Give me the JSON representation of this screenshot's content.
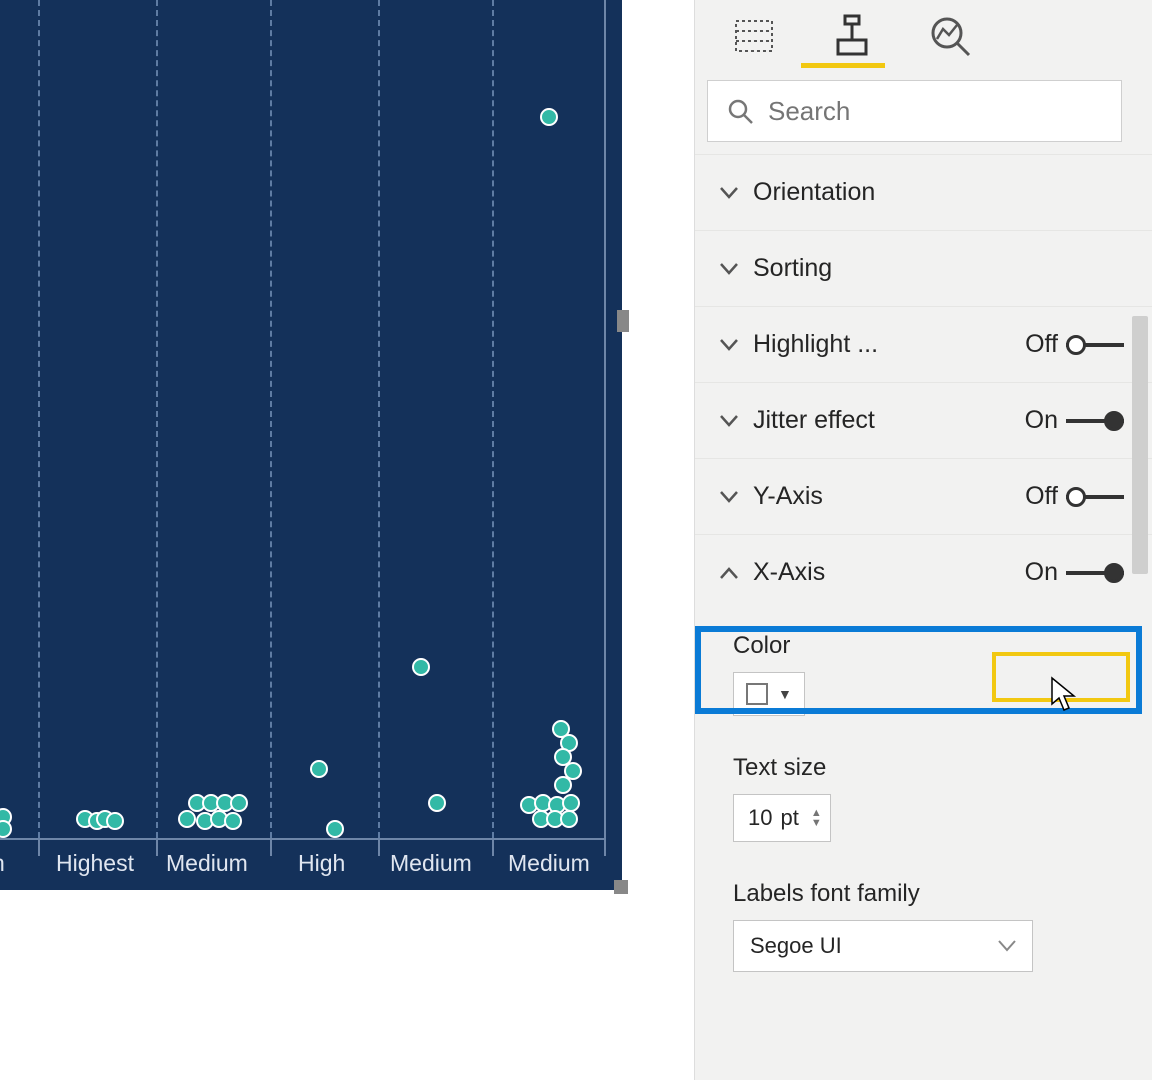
{
  "search": {
    "placeholder": "Search"
  },
  "sections": {
    "orientation": {
      "label": "Orientation"
    },
    "sorting": {
      "label": "Sorting"
    },
    "highlight": {
      "label": "Highlight ...",
      "state": "Off"
    },
    "jitter": {
      "label": "Jitter effect",
      "state": "On"
    },
    "yaxis": {
      "label": "Y-Axis",
      "state": "Off"
    },
    "xaxis": {
      "label": "X-Axis",
      "state": "On"
    }
  },
  "xaxis_settings": {
    "color_label": "Color",
    "text_size_label": "Text size",
    "text_size_value": "10",
    "text_size_unit": "pt",
    "font_family_label": "Labels font family",
    "font_family_value": "Segoe UI"
  },
  "chart_data": {
    "type": "scatter",
    "title": "",
    "xlabel": "",
    "ylabel": "",
    "categories": [
      "h",
      "Highest",
      "Medium",
      "High",
      "Medium",
      "Medium"
    ],
    "series": [
      {
        "name": "points",
        "points": [
          {
            "cat": 0,
            "y": 2
          },
          {
            "cat": 0,
            "y": 3
          },
          {
            "cat": 1,
            "y": 2
          },
          {
            "cat": 1,
            "y": 2
          },
          {
            "cat": 1,
            "y": 2
          },
          {
            "cat": 1,
            "y": 3
          },
          {
            "cat": 2,
            "y": 2
          },
          {
            "cat": 2,
            "y": 2
          },
          {
            "cat": 2,
            "y": 2
          },
          {
            "cat": 2,
            "y": 2
          },
          {
            "cat": 2,
            "y": 3
          },
          {
            "cat": 2,
            "y": 3
          },
          {
            "cat": 2,
            "y": 3
          },
          {
            "cat": 2,
            "y": 3
          },
          {
            "cat": 3,
            "y": 7
          },
          {
            "cat": 3,
            "y": 8
          },
          {
            "cat": 4,
            "y": 4
          },
          {
            "cat": 4,
            "y": 20
          },
          {
            "cat": 5,
            "y": 2
          },
          {
            "cat": 5,
            "y": 2
          },
          {
            "cat": 5,
            "y": 2
          },
          {
            "cat": 5,
            "y": 3
          },
          {
            "cat": 5,
            "y": 3
          },
          {
            "cat": 5,
            "y": 4
          },
          {
            "cat": 5,
            "y": 4
          },
          {
            "cat": 5,
            "y": 5
          },
          {
            "cat": 5,
            "y": 5
          },
          {
            "cat": 5,
            "y": 10
          },
          {
            "cat": 5,
            "y": 10
          },
          {
            "cat": 5,
            "y": 12
          },
          {
            "cat": 5,
            "y": 86
          }
        ]
      }
    ],
    "ylim": [
      0,
      100
    ],
    "grid": true,
    "colors": {
      "background": "#14315a",
      "point": "#32b9a6"
    }
  }
}
